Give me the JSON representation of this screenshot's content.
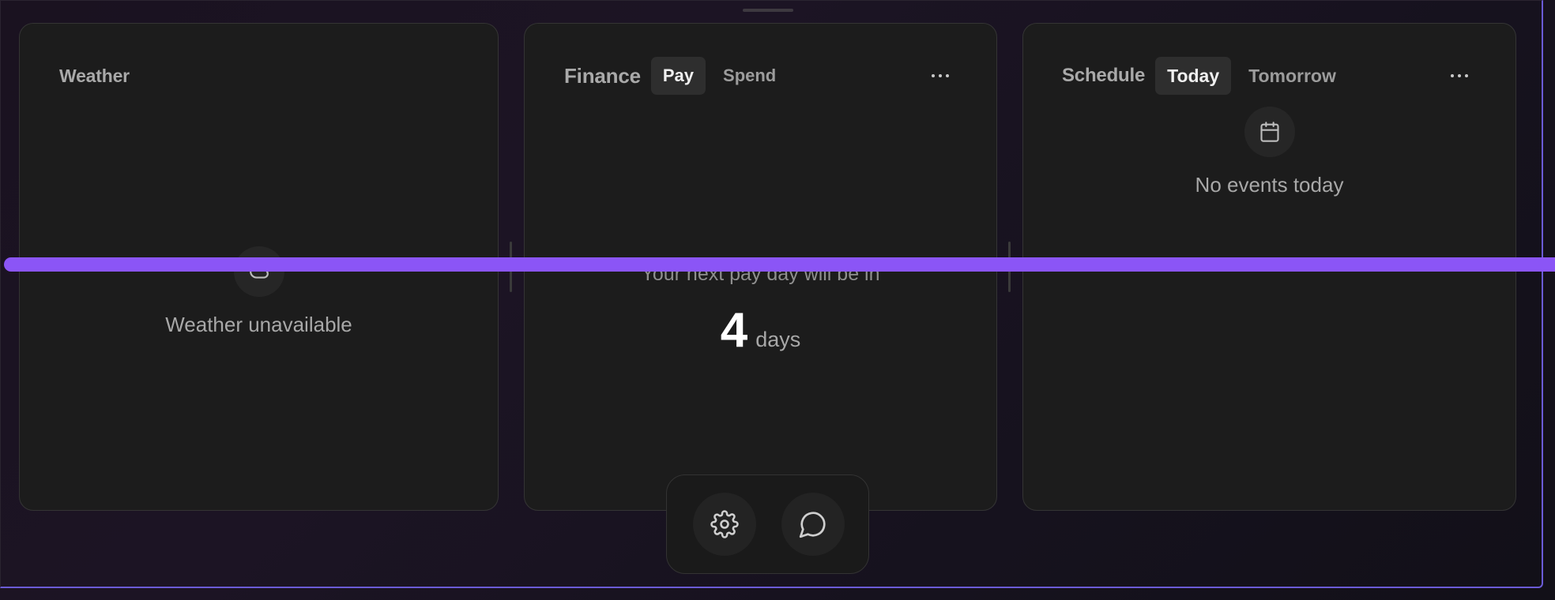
{
  "weather": {
    "title": "Weather",
    "empty_text": "Weather unavailable",
    "icon": "cloud-icon"
  },
  "finance": {
    "title": "Finance",
    "tabs": [
      {
        "label": "Pay",
        "active": true
      },
      {
        "label": "Spend",
        "active": false
      }
    ],
    "pay_message": "Your next pay day will be in",
    "pay_days": "4",
    "pay_unit": "days",
    "more_icon": "more-horizontal-icon"
  },
  "schedule": {
    "title": "Schedule",
    "tabs": [
      {
        "label": "Today",
        "active": true
      },
      {
        "label": "Tomorrow",
        "active": false
      }
    ],
    "empty_text": "No events today",
    "icon": "calendar-icon",
    "more_icon": "more-horizontal-icon"
  },
  "dock": {
    "buttons": [
      {
        "icon": "gear-icon"
      },
      {
        "icon": "chat-bubble-icon"
      }
    ]
  },
  "colors": {
    "accent": "#8b55f6",
    "card_bg": "#1c1c1c",
    "frame_border": "#6b5bd6"
  }
}
